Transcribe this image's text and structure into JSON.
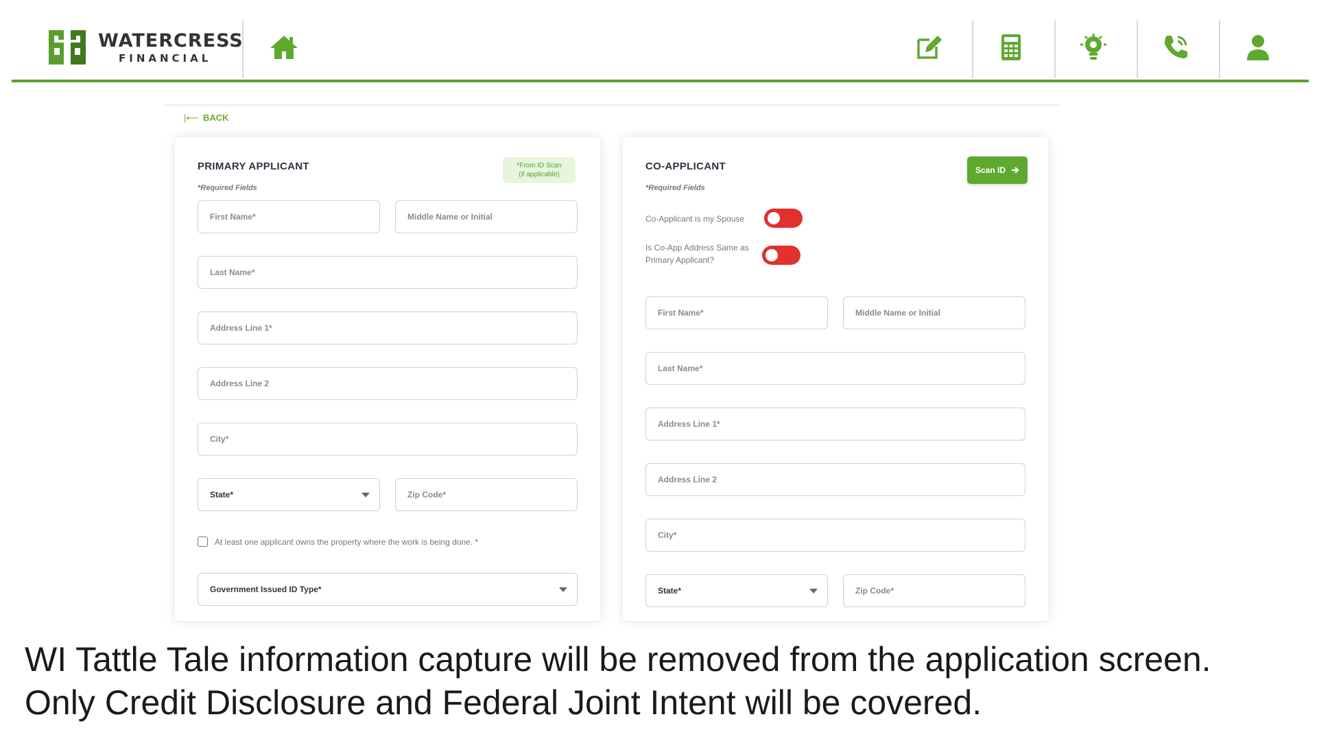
{
  "brand": {
    "name": "WATERCRESS",
    "sub": "FINANCIAL",
    "color": "#5a9e2f"
  },
  "nav": {
    "icons": [
      "home-icon",
      "edit-icon",
      "calculator-icon",
      "lightbulb-gear-icon",
      "phone-icon",
      "user-icon"
    ]
  },
  "back_label": "BACK",
  "primary": {
    "title": "PRIMARY APPLICANT",
    "required_note": "*Required Fields",
    "id_note_line1": "*From ID Scan",
    "id_note_line2": "(if applicable)",
    "fields": {
      "first_name": "First Name*",
      "middle_name": "Middle Name or Initial",
      "last_name": "Last Name*",
      "address1": "Address Line 1*",
      "address2": "Address Line 2",
      "city": "City*",
      "state": "State*",
      "zip": "Zip Code*",
      "gov_id": "Government Issued ID Type*"
    },
    "checkbox_label": "At least one applicant owns the property where the work is being done. *",
    "checkbox_checked": false
  },
  "coapplicant": {
    "title": "CO-APPLICANT",
    "required_note": "*Required Fields",
    "scan_label": "Scan ID",
    "toggle_spouse_label": "Co-Applicant is my Spouse",
    "toggle_address_line1": "Is Co-App Address Same as",
    "toggle_address_line2": "Primary Applicant?",
    "toggle_color": "#e2302c",
    "toggles_on": [
      false,
      false
    ],
    "fields": {
      "first_name": "First Name*",
      "middle_name": "Middle Name or Initial",
      "last_name": "Last Name*",
      "address1": "Address Line 1*",
      "address2": "Address Line 2",
      "city": "City*",
      "state": "State*",
      "zip": "Zip Code*"
    }
  },
  "caption": {
    "line1": "WI Tattle Tale information capture will be removed from the application screen.",
    "line2": "Only Credit Disclosure and Federal Joint Intent will be covered."
  }
}
